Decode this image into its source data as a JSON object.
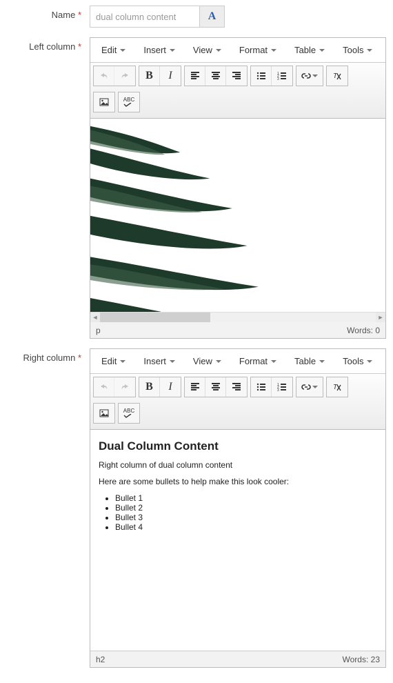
{
  "fields": {
    "name_label": "Name",
    "name_value": "dual column content",
    "name_placeholder": "",
    "left_label": "Left column",
    "right_label": "Right column",
    "required_mark": "*",
    "locale_glyph": "A"
  },
  "menubar": {
    "edit": "Edit",
    "insert": "Insert",
    "view": "View",
    "format": "Format",
    "table": "Table",
    "tools": "Tools"
  },
  "toolbar": {
    "abc": "ABC"
  },
  "left_editor": {
    "status_path": "p",
    "words_label": "Words:",
    "words_count": "0"
  },
  "right_editor": {
    "status_path": "h2",
    "words_label": "Words:",
    "words_count": "23",
    "content": {
      "heading": "Dual Column Content",
      "para1": "Right column of dual column content",
      "para2": "Here are some bullets to help make this look cooler:",
      "bullets": {
        "b0": "Bullet 1",
        "b1": "Bullet 2",
        "b2": "Bullet 3",
        "b3": "Bullet 4"
      }
    }
  }
}
